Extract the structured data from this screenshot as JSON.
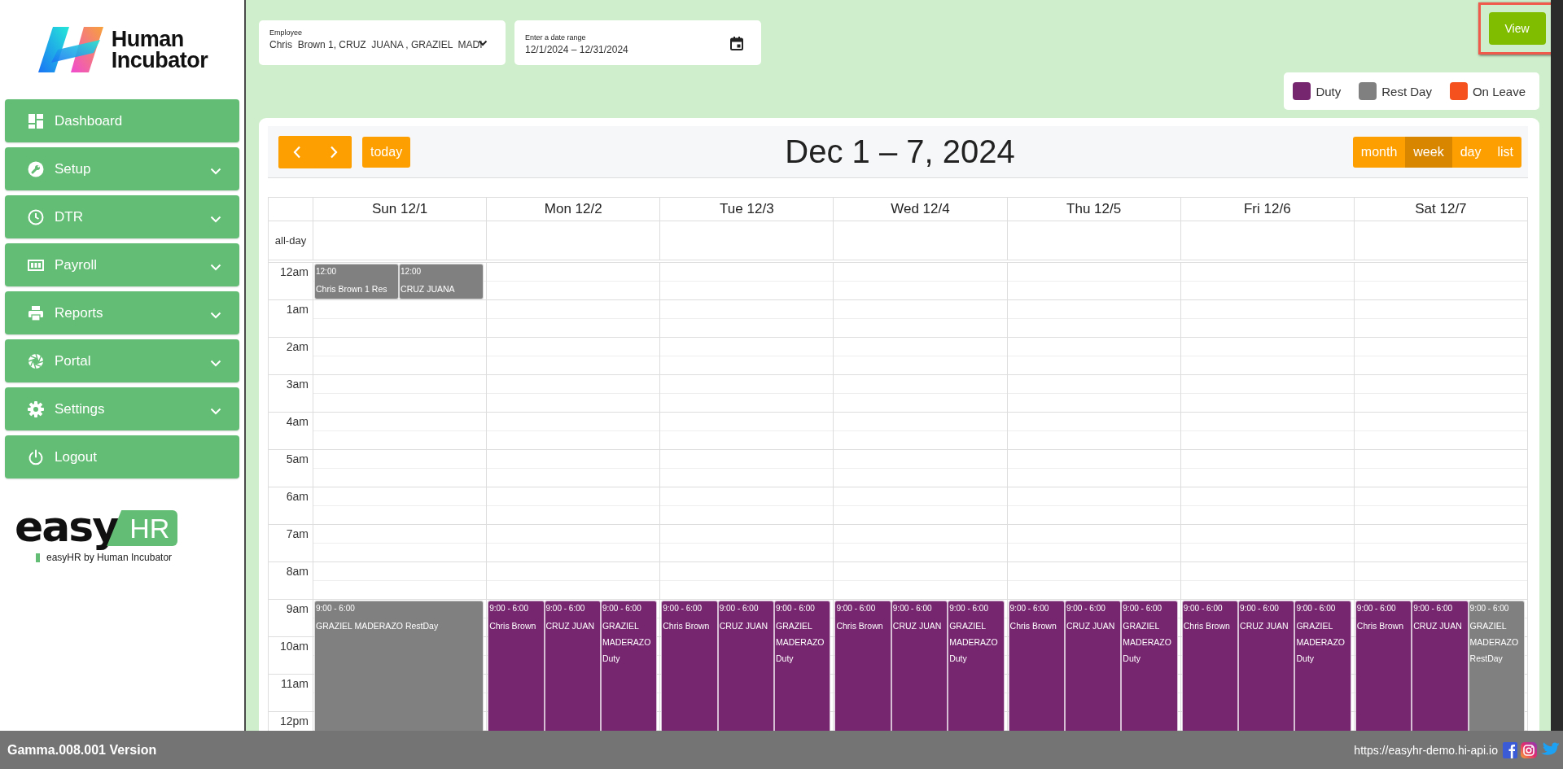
{
  "sidebar": {
    "logo": {
      "lines": [
        "Human",
        "Incubator"
      ]
    },
    "menu": [
      {
        "label": "Dashboard",
        "expandable": false
      },
      {
        "label": "Setup",
        "expandable": true
      },
      {
        "label": "DTR",
        "expandable": true
      },
      {
        "label": "Payroll",
        "expandable": true
      },
      {
        "label": "Reports",
        "expandable": true
      },
      {
        "label": "Portal",
        "expandable": true
      },
      {
        "label": "Settings",
        "expandable": true
      },
      {
        "label": "Logout",
        "expandable": false
      }
    ],
    "brand": {
      "word": "easy",
      "badge": "HR",
      "tagline": "easyHR by Human Incubator"
    }
  },
  "filters": {
    "employee": {
      "label": "Employee",
      "value": "Chris  Brown 1, CRUZ  JUANA , GRAZIEL  MADI"
    },
    "date_range": {
      "label": "Enter a date range",
      "value": "12/1/2024 – 12/31/2024"
    }
  },
  "view_button": "View",
  "legend": [
    {
      "label": "Duty",
      "color": "#76266f"
    },
    {
      "label": "Rest Day",
      "color": "#808080"
    },
    {
      "label": "On Leave",
      "color": "#f4511e"
    }
  ],
  "calendar": {
    "today_button": "today",
    "title": "Dec 1 – 7, 2024",
    "views": [
      {
        "label": "month",
        "selected": false
      },
      {
        "label": "week",
        "selected": true
      },
      {
        "label": "day",
        "selected": false
      },
      {
        "label": "list",
        "selected": false
      }
    ],
    "all_day_label": "all-day",
    "hours": [
      "12am",
      "1am",
      "2am",
      "3am",
      "4am",
      "5am",
      "6am",
      "7am",
      "8am",
      "9am",
      "10am",
      "11am",
      "12pm"
    ],
    "days": [
      {
        "header": "Sun 12/1",
        "events": [
          {
            "kind": "rest",
            "time": "12:00",
            "title": "Chris Brown 1 Res"
          },
          {
            "kind": "rest",
            "time": "12:00",
            "title": "CRUZ JUANA"
          },
          {
            "kind": "rest",
            "time": "9:00 - 6:00",
            "title": "GRAZIEL MADERAZO RestDay"
          }
        ]
      },
      {
        "header": "Mon 12/2",
        "events": [
          {
            "kind": "duty",
            "time": "9:00 - 6:00",
            "title": "Chris Brown"
          },
          {
            "kind": "duty",
            "time": "9:00 - 6:00",
            "title": "CRUZ JUAN"
          },
          {
            "kind": "duty",
            "time": "9:00 - 6:00",
            "title": "GRAZIEL MADERAZO Duty"
          }
        ]
      },
      {
        "header": "Tue 12/3",
        "events": [
          {
            "kind": "duty",
            "time": "9:00 - 6:00",
            "title": "Chris Brown"
          },
          {
            "kind": "duty",
            "time": "9:00 - 6:00",
            "title": "CRUZ JUAN"
          },
          {
            "kind": "duty",
            "time": "9:00 - 6:00",
            "title": "GRAZIEL MADERAZO Duty"
          }
        ]
      },
      {
        "header": "Wed 12/4",
        "events": [
          {
            "kind": "duty",
            "time": "9:00 - 6:00",
            "title": "Chris Brown"
          },
          {
            "kind": "duty",
            "time": "9:00 - 6:00",
            "title": "CRUZ JUAN"
          },
          {
            "kind": "duty",
            "time": "9:00 - 6:00",
            "title": "GRAZIEL MADERAZO Duty"
          }
        ]
      },
      {
        "header": "Thu 12/5",
        "events": [
          {
            "kind": "duty",
            "time": "9:00 - 6:00",
            "title": "Chris Brown"
          },
          {
            "kind": "duty",
            "time": "9:00 - 6:00",
            "title": "CRUZ JUAN"
          },
          {
            "kind": "duty",
            "time": "9:00 - 6:00",
            "title": "GRAZIEL MADERAZO Duty"
          }
        ]
      },
      {
        "header": "Fri 12/6",
        "events": [
          {
            "kind": "duty",
            "time": "9:00 - 6:00",
            "title": "Chris Brown"
          },
          {
            "kind": "duty",
            "time": "9:00 - 6:00",
            "title": "CRUZ JUAN"
          },
          {
            "kind": "duty",
            "time": "9:00 - 6:00",
            "title": "GRAZIEL MADERAZO Duty"
          }
        ]
      },
      {
        "header": "Sat 12/7",
        "events": [
          {
            "kind": "duty",
            "time": "9:00 - 6:00",
            "title": "Chris Brown"
          },
          {
            "kind": "duty",
            "time": "9:00 - 6:00",
            "title": "CRUZ JUAN"
          },
          {
            "kind": "rest",
            "time": "9:00 - 6:00",
            "title": "GRAZIEL MADERAZO RestDay"
          }
        ]
      }
    ]
  },
  "footer": {
    "version": "Gamma.008.001 Version",
    "url": "https://easyhr-demo.hi-api.io"
  }
}
